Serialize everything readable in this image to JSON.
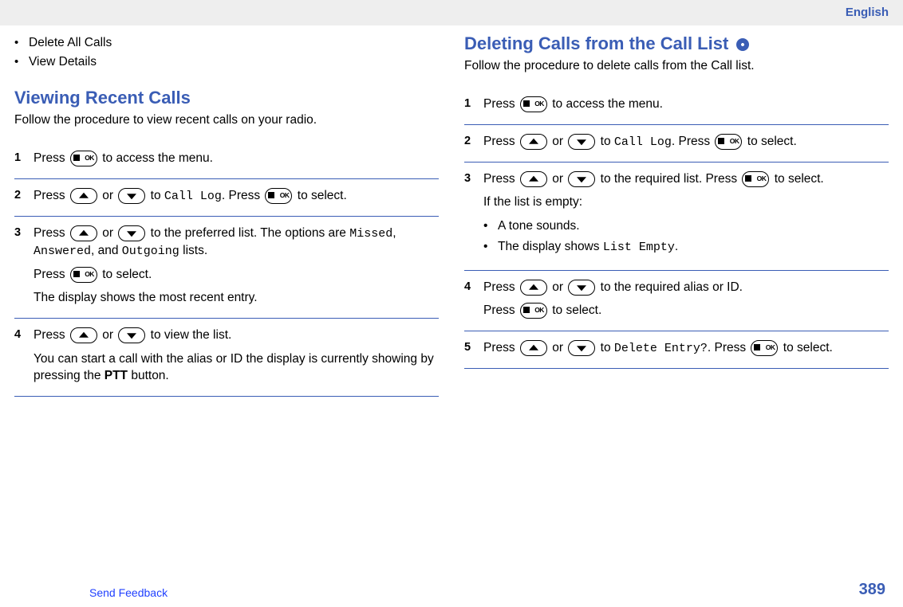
{
  "header": {
    "language": "English"
  },
  "leftColumn": {
    "topBullets": [
      "Delete All Calls",
      "View Details"
    ],
    "heading": "Viewing Recent Calls",
    "intro": "Follow the procedure to view recent calls on your radio.",
    "steps": {
      "s1": {
        "num": "1",
        "t1a": "Press ",
        "t1b": " to access the menu."
      },
      "s2": {
        "num": "2",
        "t1a": "Press ",
        "t1b": " or ",
        "t1c": " to ",
        "mono1": "Call Log",
        "t1d": ". Press ",
        "t1e": " to select."
      },
      "s3": {
        "num": "3",
        "p1a": "Press ",
        "p1b": " or ",
        "p1c": " to the preferred list. The options are ",
        "mono1": "Missed",
        "p1d": ", ",
        "mono2": "Answered",
        "p1e": ", and ",
        "mono3": "Outgoing",
        "p1f": " lists.",
        "p2a": "Press ",
        "p2b": " to select.",
        "p3": "The display shows the most recent entry."
      },
      "s4": {
        "num": "4",
        "p1a": "Press ",
        "p1b": " or ",
        "p1c": " to view the list.",
        "p2a": "You can start a call with the alias or ID the display is currently showing by pressing the ",
        "ptt": "PTT",
        "p2b": " button."
      }
    }
  },
  "rightColumn": {
    "heading": "Deleting Calls from the Call List",
    "intro": "Follow the procedure to delete calls from the Call list.",
    "steps": {
      "s1": {
        "num": "1",
        "t1a": "Press ",
        "t1b": " to access the menu."
      },
      "s2": {
        "num": "2",
        "t1a": "Press ",
        "t1b": " or ",
        "t1c": " to ",
        "mono1": "Call Log",
        "t1d": ". Press ",
        "t1e": " to select."
      },
      "s3": {
        "num": "3",
        "p1a": "Press ",
        "p1b": " or ",
        "p1c": " to the required list. Press ",
        "p1d": " to select.",
        "p2": "If the list is empty:",
        "bullets": {
          "b1": "A tone sounds.",
          "b2a": "The display shows ",
          "mono1": "List Empty",
          "b2b": "."
        }
      },
      "s4": {
        "num": "4",
        "p1a": "Press ",
        "p1b": " or ",
        "p1c": " to the required alias or ID.",
        "p2a": "Press ",
        "p2b": " to select."
      },
      "s5": {
        "num": "5",
        "p1a": "Press ",
        "p1b": " or ",
        "p1c": " to ",
        "mono1": "Delete Entry?",
        "p1d": ". Press ",
        "p1e": " to select."
      }
    }
  },
  "footer": {
    "feedback": "Send Feedback",
    "pageNumber": "389"
  }
}
